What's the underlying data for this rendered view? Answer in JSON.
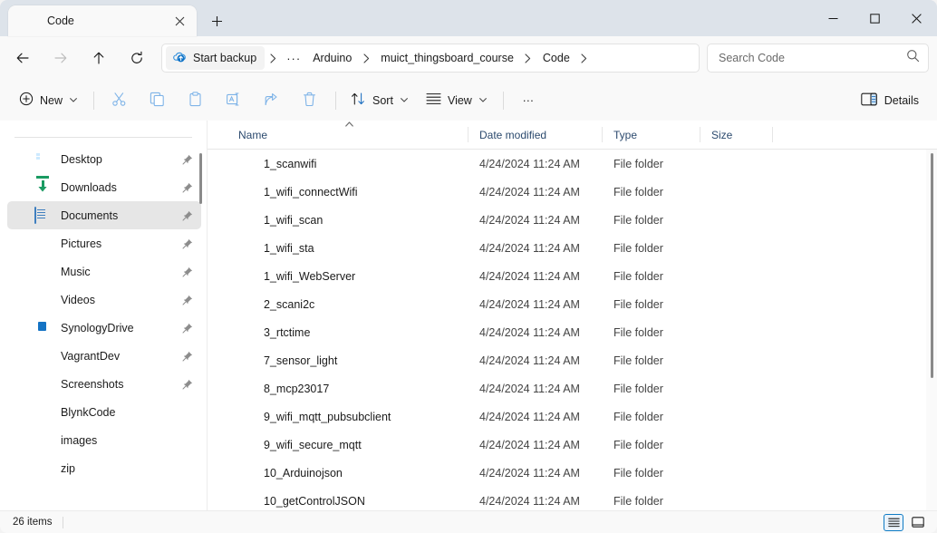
{
  "window": {
    "tab_title": "Code",
    "tab_icon": "folder-icon",
    "close_tab_icon": "close-icon",
    "new_tab_icon": "plus-icon",
    "minimize_icon": "minimize-icon",
    "maximize_icon": "maximize-icon",
    "close_icon": "close-icon"
  },
  "nav": {
    "back_icon": "arrow-left-icon",
    "forward_icon": "arrow-right-icon",
    "up_icon": "arrow-up-icon",
    "refresh_icon": "refresh-icon"
  },
  "breadcrumb": {
    "backup_label": "Start backup",
    "backup_icon": "onedrive-cloud-icon",
    "overflow": "···",
    "separator": "›",
    "items": [
      "Arduino",
      "muict_thingsboard_course",
      "Code"
    ]
  },
  "search": {
    "placeholder": "Search Code",
    "value": "",
    "icon": "search-icon"
  },
  "toolbar": {
    "new_label": "New",
    "new_icon": "plus-circle-icon",
    "cut_icon": "scissors-icon",
    "copy_icon": "copy-icon",
    "paste_icon": "paste-icon",
    "rename_icon": "rename-icon",
    "share_icon": "share-icon",
    "delete_icon": "trash-icon",
    "sort_label": "Sort",
    "sort_icon": "sort-arrows-icon",
    "view_label": "View",
    "view_icon": "list-lines-icon",
    "more_label": "···",
    "details_label": "Details",
    "details_icon": "details-pane-icon",
    "chevron": "⌄"
  },
  "sidebar": {
    "items": [
      {
        "label": "Desktop",
        "icon": "desktop-icon",
        "pinned": true,
        "selected": false
      },
      {
        "label": "Downloads",
        "icon": "download-icon",
        "pinned": true,
        "selected": false
      },
      {
        "label": "Documents",
        "icon": "documents-icon",
        "pinned": true,
        "selected": true
      },
      {
        "label": "Pictures",
        "icon": "pictures-icon",
        "pinned": true,
        "selected": false
      },
      {
        "label": "Music",
        "icon": "music-icon",
        "pinned": true,
        "selected": false
      },
      {
        "label": "Videos",
        "icon": "videos-icon",
        "pinned": true,
        "selected": false
      },
      {
        "label": "SynologyDrive",
        "icon": "synology-drive-icon",
        "pinned": true,
        "selected": false
      },
      {
        "label": "VagrantDev",
        "icon": "folder-icon",
        "pinned": true,
        "selected": false
      },
      {
        "label": "Screenshots",
        "icon": "folder-icon",
        "pinned": true,
        "selected": false
      },
      {
        "label": "BlynkCode",
        "icon": "folder-icon",
        "pinned": false,
        "selected": false
      },
      {
        "label": "images",
        "icon": "folder-icon",
        "pinned": false,
        "selected": false
      },
      {
        "label": "zip",
        "icon": "folder-icon",
        "pinned": false,
        "selected": false
      }
    ]
  },
  "filelist": {
    "columns": [
      "Name",
      "Date modified",
      "Type",
      "Size"
    ],
    "sort_column": "Name",
    "sort_direction": "ascending",
    "rows": [
      {
        "name": "1_scanwifi",
        "date": "4/24/2024 11:24 AM",
        "type": "File folder",
        "size": ""
      },
      {
        "name": "1_wifi_connectWifi",
        "date": "4/24/2024 11:24 AM",
        "type": "File folder",
        "size": ""
      },
      {
        "name": "1_wifi_scan",
        "date": "4/24/2024 11:24 AM",
        "type": "File folder",
        "size": ""
      },
      {
        "name": "1_wifi_sta",
        "date": "4/24/2024 11:24 AM",
        "type": "File folder",
        "size": ""
      },
      {
        "name": "1_wifi_WebServer",
        "date": "4/24/2024 11:24 AM",
        "type": "File folder",
        "size": ""
      },
      {
        "name": "2_scani2c",
        "date": "4/24/2024 11:24 AM",
        "type": "File folder",
        "size": ""
      },
      {
        "name": "3_rtctime",
        "date": "4/24/2024 11:24 AM",
        "type": "File folder",
        "size": ""
      },
      {
        "name": "7_sensor_light",
        "date": "4/24/2024 11:24 AM",
        "type": "File folder",
        "size": ""
      },
      {
        "name": "8_mcp23017",
        "date": "4/24/2024 11:24 AM",
        "type": "File folder",
        "size": ""
      },
      {
        "name": "9_wifi_mqtt_pubsubclient",
        "date": "4/24/2024 11:24 AM",
        "type": "File folder",
        "size": ""
      },
      {
        "name": "9_wifi_secure_mqtt",
        "date": "4/24/2024 11:24 AM",
        "type": "File folder",
        "size": ""
      },
      {
        "name": "10_Arduinojson",
        "date": "4/24/2024 11:24 AM",
        "type": "File folder",
        "size": ""
      },
      {
        "name": "10_getControlJSON",
        "date": "4/24/2024 11:24 AM",
        "type": "File folder",
        "size": ""
      }
    ]
  },
  "statusbar": {
    "item_count": "26 items",
    "details_view_icon": "details-view-icon",
    "large_icons_view_icon": "large-icons-view-icon"
  },
  "colors": {
    "accent": "#0f7bc4",
    "titlebar_bg": "#dde3ea",
    "chrome_bg": "#f9f9f9",
    "selection": "#e6e6e6",
    "folder_yellow": "#f5bc3a"
  }
}
